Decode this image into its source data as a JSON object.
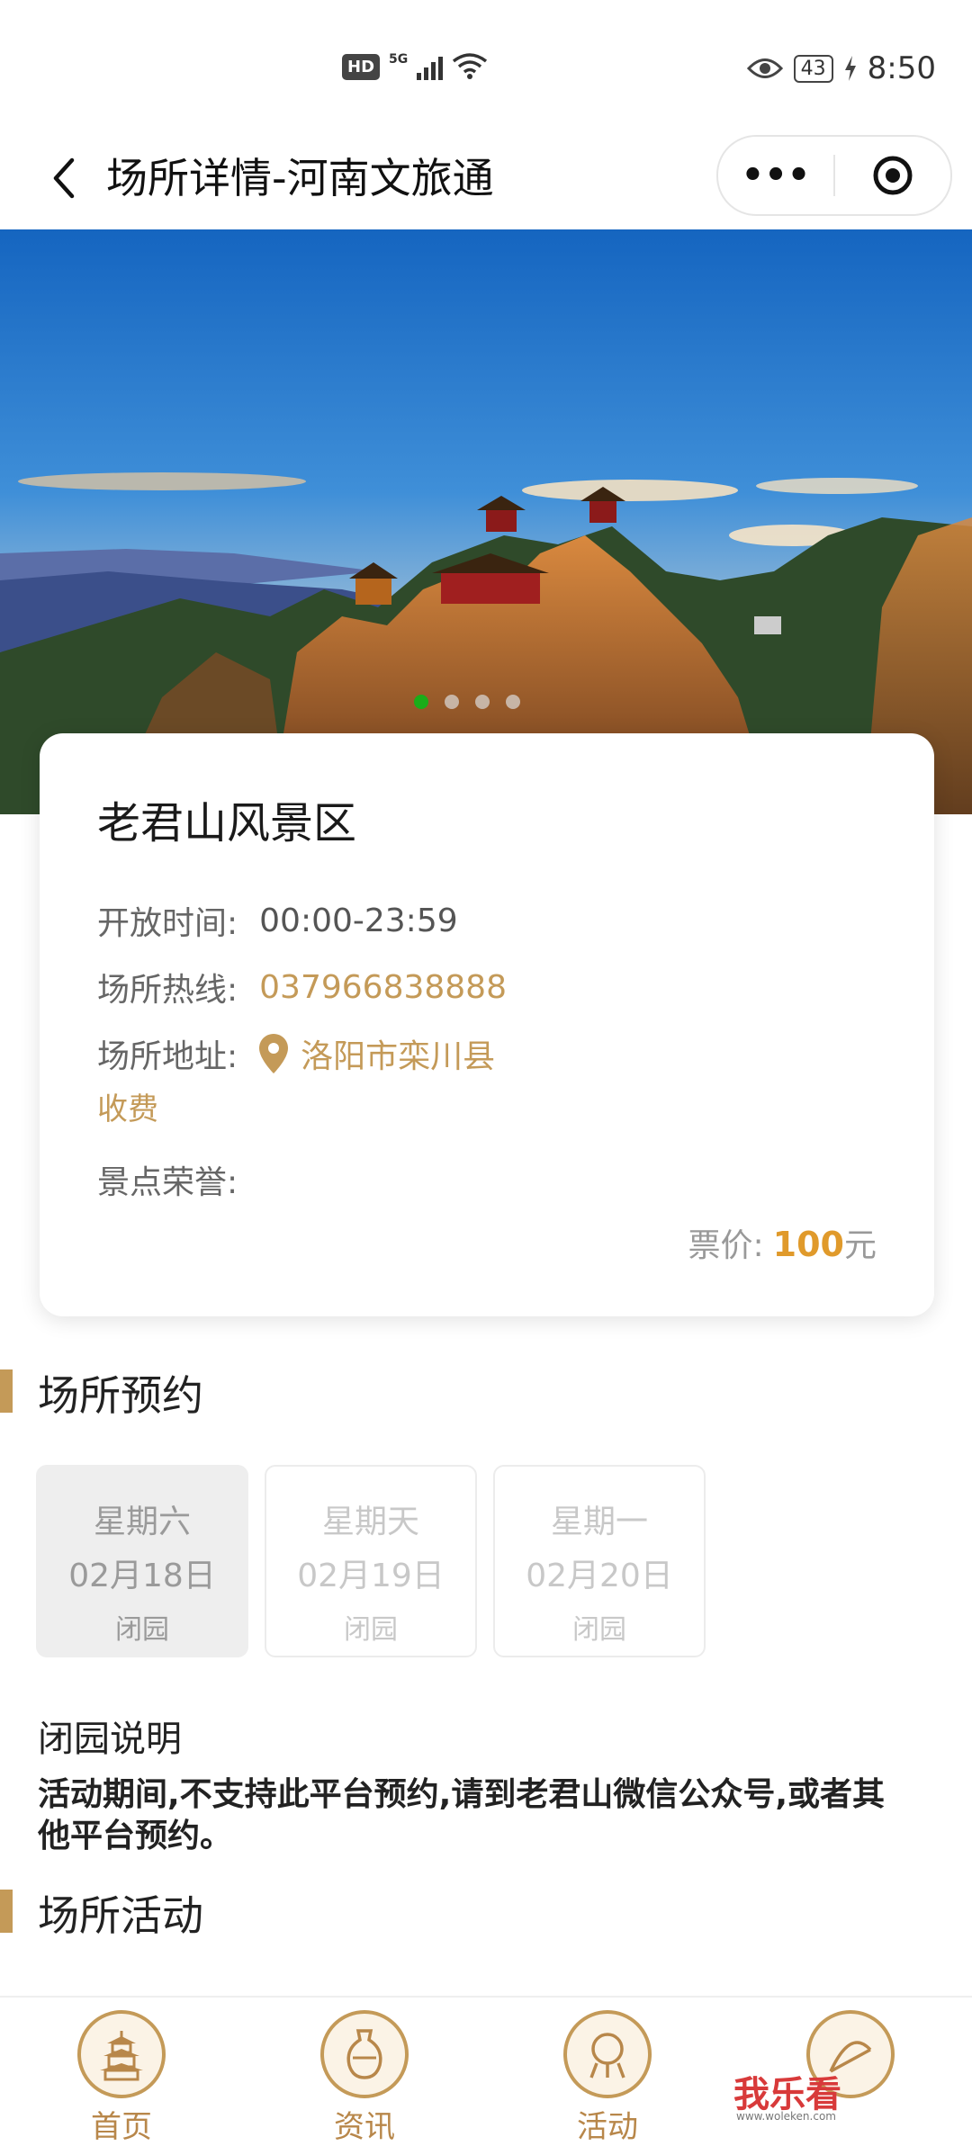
{
  "status_bar": {
    "hd": "HD",
    "signal": "5G",
    "battery": "43",
    "time": "8:50"
  },
  "navbar": {
    "title": "场所详情-河南文旅通",
    "more_label": "•••"
  },
  "venue": {
    "name": "老君山风景区",
    "open_hours_label": "开放时间:",
    "open_hours": "00:00-23:59",
    "hotline_label": "场所热线:",
    "hotline": "037966838888",
    "address_label": "场所地址:",
    "address": "洛阳市栾川县",
    "fee": "收费",
    "honor_label": "景点荣誉:",
    "price_label": "票价:",
    "price_value": "100",
    "price_unit": "元"
  },
  "reservation": {
    "title": "场所预约",
    "days": [
      {
        "weekday": "星期六",
        "date": "02月18日",
        "status": "闭园"
      },
      {
        "weekday": "星期天",
        "date": "02月19日",
        "status": "闭园"
      },
      {
        "weekday": "星期一",
        "date": "02月20日",
        "status": "闭园"
      }
    ],
    "closure_title": "闭园说明",
    "closure_desc": "活动期间,不支持此平台预约,请到老君山微信公众号,或者其他平台预约。"
  },
  "activities": {
    "title": "场所活动"
  },
  "tabbar": {
    "tabs": [
      {
        "label": "首页"
      },
      {
        "label": "资讯"
      },
      {
        "label": "活动"
      }
    ]
  },
  "watermark": {
    "text": "我乐看",
    "sub": "www.woleken.com"
  },
  "colors": {
    "accent": "#c49a58",
    "price": "#e09a2b",
    "active_dot": "#1aad19"
  }
}
